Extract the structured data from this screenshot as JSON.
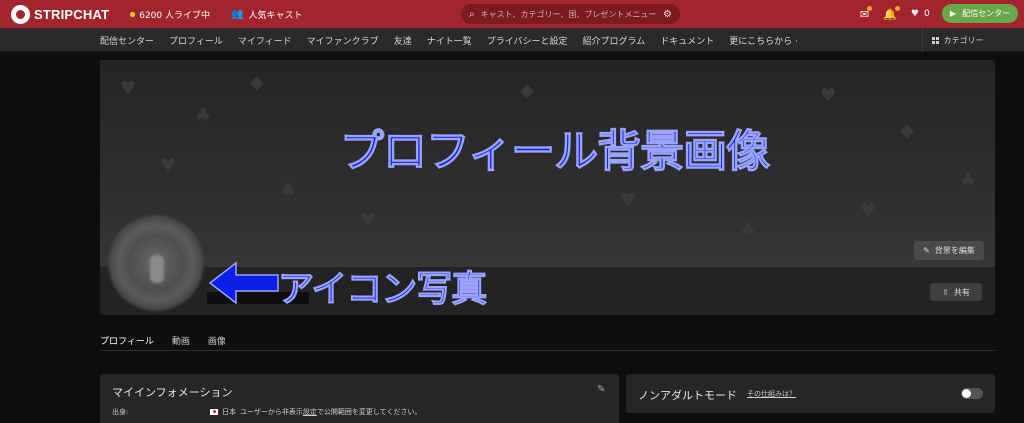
{
  "header": {
    "logo_text": "STRIPCHAT",
    "online_count": "6200 人ライブ中",
    "popular": "人気キャスト",
    "search_placeholder": "キャスト、カテゴリー、国、プレゼントメニュー",
    "likes_count": "0",
    "broadcast_button": "配信センター"
  },
  "subnav": {
    "items": [
      "配信センター",
      "プロフィール",
      "マイフィード",
      "マイファンクラブ",
      "友達",
      "ナイト一覧",
      "プライバシーと設定",
      "紹介プログラム",
      "ドキュメント",
      "更にこちらから ·"
    ],
    "category": "カテゴリー"
  },
  "cover": {
    "annotation_title": "プロフィール背景画像",
    "edit_background": "背景を編集",
    "share": "共有",
    "annotation_icon": "アイコン写真"
  },
  "tabs": [
    "プロフィール",
    "動画",
    "画像"
  ],
  "info_panel": {
    "title": "マイインフォメーション",
    "origin_label": "出身:",
    "country": "日本",
    "hidden_text_before": "ユーザーから非表示",
    "settings_link": "設定",
    "hidden_text_after": "で公開範囲を変更してください。"
  },
  "nonadult_panel": {
    "title": "ノンアダルトモード",
    "how_link": "その仕組みは？"
  },
  "colors": {
    "topbar": "#a2252d",
    "annotation_blue": "#0b1fe6",
    "broadcast_green": "#6aa64a"
  }
}
